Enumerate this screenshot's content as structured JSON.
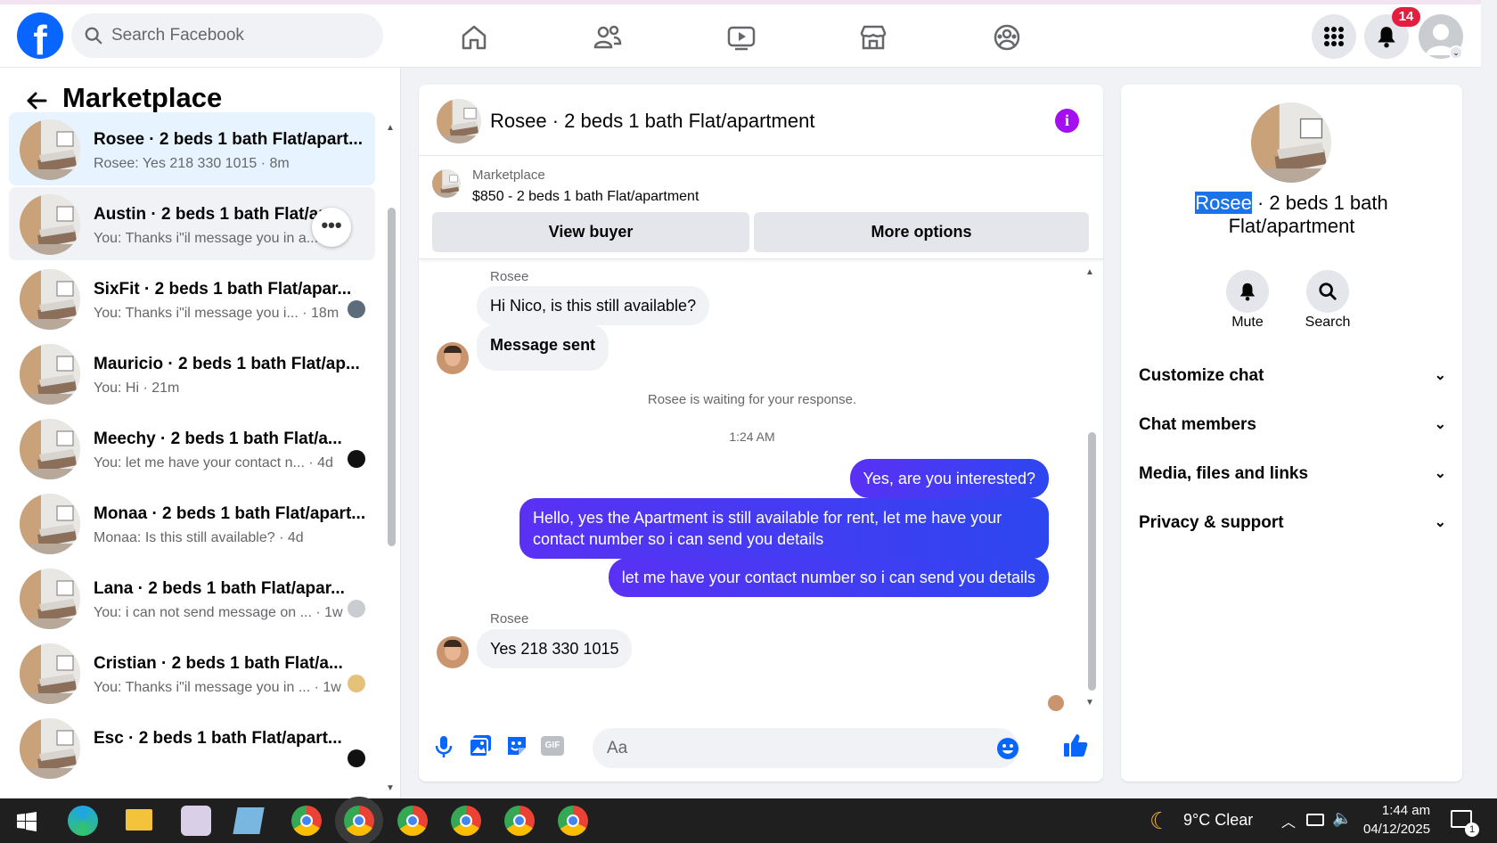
{
  "search": {
    "placeholder": "Search Facebook"
  },
  "notifications": {
    "count": "14"
  },
  "left": {
    "title": "Marketplace",
    "conversations": [
      {
        "title": "Rosee · 2 beds 1 bath Flat/apart...",
        "snippet": "Rosee: Yes 218 330 1015 · 8m"
      },
      {
        "title": "Austin · 2 beds 1 bath Flat/ap...",
        "snippet": "You: Thanks i\"il message you in a... 1m"
      },
      {
        "title": "SixFit · 2 beds 1 bath Flat/apar...",
        "snippet": "You: Thanks i\"il message you i... · 18m"
      },
      {
        "title": "Mauricio · 2 beds 1 bath Flat/ap...",
        "snippet": "You: Hi · 21m"
      },
      {
        "title": "Meechy · 2 beds 1 bath Flat/a...",
        "snippet": "You: let me have your contact n... · 4d"
      },
      {
        "title": "Monaa · 2 beds 1 bath Flat/apart...",
        "snippet": "Monaa: Is this still available? · 4d"
      },
      {
        "title": "Lana · 2 beds 1 bath Flat/apar...",
        "snippet": "You: i can not send message on ... · 1w"
      },
      {
        "title": "Cristian · 2 beds 1 bath Flat/a...",
        "snippet": "You: Thanks i\"il message you in ... · 1w"
      },
      {
        "title": "Esc · 2 beds 1 bath Flat/apart...",
        "snippet": ""
      }
    ]
  },
  "chat": {
    "title": "Rosee · 2 beds 1 bath Flat/apartment",
    "marketplace_label": "Marketplace",
    "listing": "$850 - 2 beds 1 bath Flat/apartment",
    "view_buyer": "View buyer",
    "more_options": "More options",
    "sender1": "Rosee",
    "msg1": "Hi Nico, is this still available?",
    "msg2": "Message sent",
    "waiting": "Rosee is waiting for your response.",
    "time": "1:24 AM",
    "out1": "Yes, are you interested?",
    "out2a": "Hello, yes the Apartment is still available for rent, let me have your",
    "out2b": "contact number so i can send you details",
    "out3": "let me have your contact number so i can send you details",
    "sender2": "Rosee",
    "msg3": "Yes 218 330 1015",
    "composer_placeholder": "Aa",
    "gif": "GIF"
  },
  "details": {
    "name_highlight": "Rosee",
    "name_rest": " · 2 beds 1 bath",
    "name_line2": "Flat/apartment",
    "mute": "Mute",
    "search": "Search",
    "sections": [
      "Customize chat",
      "Chat members",
      "Media, files and links",
      "Privacy & support"
    ]
  },
  "taskbar": {
    "weather": "9°C  Clear",
    "time": "1:44 am",
    "date": "04/12/2025",
    "notif": "1"
  },
  "colors": {
    "brand": "#0866ff",
    "outgoing": "#4a3cf2",
    "selected": "#e7f3ff"
  }
}
